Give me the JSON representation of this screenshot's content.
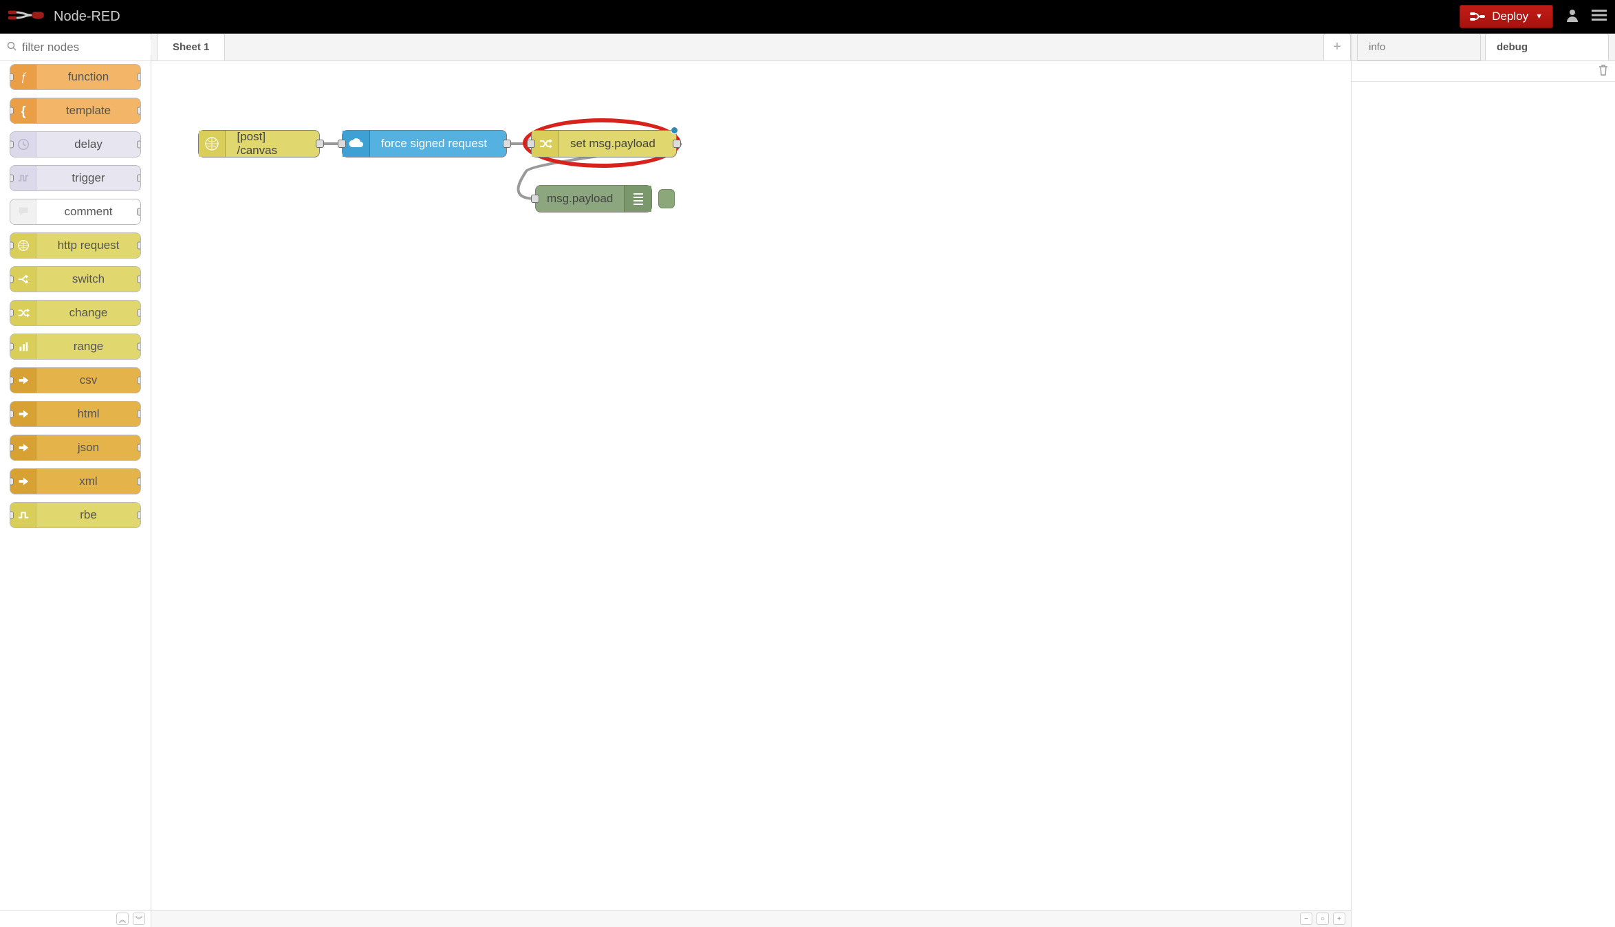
{
  "header": {
    "brand": "Node-RED",
    "deploy": "Deploy"
  },
  "palette": {
    "search_placeholder": "filter nodes",
    "nodes": [
      {
        "label": "function",
        "color": "orange1",
        "icon": "f-italic"
      },
      {
        "label": "template",
        "color": "orange1",
        "icon": "brace"
      },
      {
        "label": "delay",
        "color": "lav1",
        "icon": "clock"
      },
      {
        "label": "trigger",
        "color": "lav1",
        "icon": "pulse"
      },
      {
        "label": "comment",
        "color": "white1",
        "icon": "bubble",
        "out_only": true
      },
      {
        "label": "http request",
        "color": "yellow1",
        "icon": "globe"
      },
      {
        "label": "switch",
        "color": "yellow1",
        "icon": "switch"
      },
      {
        "label": "change",
        "color": "yellow1",
        "icon": "shuffle"
      },
      {
        "label": "range",
        "color": "yellow1",
        "icon": "bars"
      },
      {
        "label": "csv",
        "color": "amber1",
        "icon": "arrow"
      },
      {
        "label": "html",
        "color": "amber1",
        "icon": "arrow"
      },
      {
        "label": "json",
        "color": "amber1",
        "icon": "arrow"
      },
      {
        "label": "xml",
        "color": "amber1",
        "icon": "arrow"
      },
      {
        "label": "rbe",
        "color": "yellow1",
        "icon": "pulse2"
      }
    ]
  },
  "tabs": {
    "sheets": [
      "Sheet 1"
    ]
  },
  "flow": {
    "n1": {
      "label": "[post] /canvas"
    },
    "n2": {
      "label": "force signed request"
    },
    "n3": {
      "label": "set msg.payload"
    },
    "n4": {
      "label": "msg.payload"
    }
  },
  "sidebar": {
    "tabs": [
      "info",
      "debug"
    ],
    "active": "debug"
  }
}
